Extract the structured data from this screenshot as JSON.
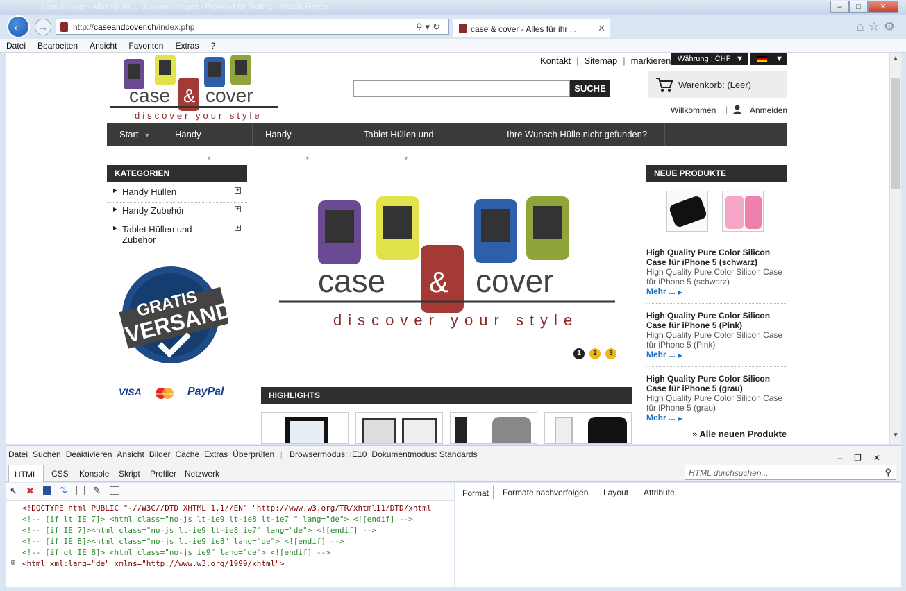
{
  "window": {
    "title_ghost": "case & cover - Alles für ihr ... Scenario Images - Provided for Testing - Mozilla Firefox"
  },
  "browser": {
    "url_prefix": "http://",
    "url_domain": "caseandcover.ch",
    "url_path": "/index.php",
    "tab_title": "case & cover - Alles für ihr ...",
    "menu": [
      "Datei",
      "Bearbeiten",
      "Ansicht",
      "Favoriten",
      "Extras",
      "?"
    ]
  },
  "site": {
    "top_links": [
      "Kontakt",
      "Sitemap",
      "markieren"
    ],
    "currency": "Währung : CHF",
    "search_button": "SUCHE",
    "cart": "Warenkorb: (Leer)",
    "welcome": "Willkommen",
    "login": "Anmelden",
    "logo_text": "case & cover",
    "logo_tagline": "discover your style",
    "nav": [
      "Start",
      "Handy Hüllen",
      "Handy Zubehör",
      "Tablet Hüllen und Zubehör",
      "Ihre Wunsch Hülle nicht gefunden?"
    ],
    "categories_title": "KATEGORIEN",
    "categories": [
      "Handy Hüllen",
      "Handy Zubehör",
      "Tablet Hüllen und Zubehör"
    ],
    "badge_line1": "GRATIS",
    "badge_line2": "VERSAND",
    "payments": [
      "VISA",
      "MasterCard",
      "PayPal"
    ],
    "slider_pages": [
      "1",
      "2",
      "3"
    ],
    "highlights_title": "HIGHLIGHTS",
    "new_products_title": "NEUE PRODUKTE",
    "new_products": [
      {
        "title": "High Quality Pure Color Silicon Case für iPhone 5 (schwarz)",
        "desc": "High Quality Pure Color Silicon Case für iPhone 5 (schwarz)",
        "more": "Mehr ..."
      },
      {
        "title": "High Quality Pure Color Silicon Case für iPhone 5 (Pink)",
        "desc": "High Quality Pure Color Silicon Case für iPhone 5 (Pink)",
        "more": "Mehr ..."
      },
      {
        "title": "High Quality Pure Color Silicon Case für iPhone 5 (grau)",
        "desc": "High Quality Pure Color Silicon Case für iPhone 5 (grau)",
        "more": "Mehr ..."
      }
    ],
    "all_new": "» Alle neuen Produkte"
  },
  "devtools": {
    "menu": [
      "Datei",
      "Suchen",
      "Deaktivieren",
      "Ansicht",
      "Bilder",
      "Cache",
      "Extras",
      "Überprüfen"
    ],
    "browser_mode": "Browsermodus: IE10",
    "doc_mode": "Dokumentmodus: Standards",
    "tabs": [
      "HTML",
      "CSS",
      "Konsole",
      "Skript",
      "Profiler",
      "Netzwerk"
    ],
    "search_placeholder": "HTML durchsuchen...",
    "right_tabs": [
      "Format",
      "Formate nachverfolgen",
      "Layout",
      "Attribute"
    ],
    "source": [
      "<!DOCTYPE html PUBLIC \"-//W3C//DTD XHTML 1.1//EN\" \"http://www.w3.org/TR/xhtml11/DTD/xhtml",
      "<!-- [if lt IE 7]> <html class=\"no-js lt-ie9 lt-ie8 lt-ie7 \" lang=\"de\"> <![endif] -->",
      "<!-- [if IE 7]><html class=\"no-js lt-ie9 lt-ie8 ie7\" lang=\"de\"> <![endif] -->",
      "<!-- [if IE 8]><html class=\"no-js lt-ie9 ie8\" lang=\"de\"> <![endif] -->",
      "<!-- [if gt IE 8]> <html class=\"no-js ie9\" lang=\"de\"> <![endif] -->",
      "<html xml:lang=\"de\" xmlns=\"http://www.w3.org/1999/xhtml\">"
    ]
  },
  "colors": {
    "accent": "#1a73c9",
    "nav_bg": "#3a3a3a",
    "brand_red": "#8b2a2a"
  }
}
